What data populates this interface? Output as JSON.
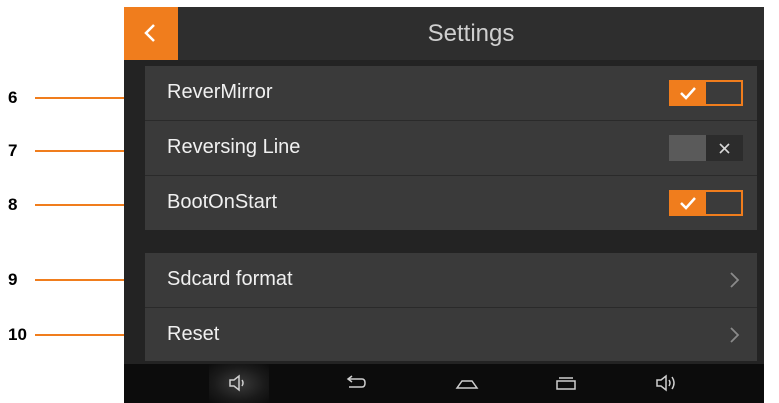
{
  "header": {
    "title": "Settings",
    "back_icon": "chevron-left-icon"
  },
  "settings": {
    "toggles": [
      {
        "label": "ReverMirror",
        "state": "on"
      },
      {
        "label": "Reversing Line",
        "state": "off"
      },
      {
        "label": "BootOnStart",
        "state": "on"
      }
    ],
    "actions": [
      {
        "label": "Sdcard format"
      },
      {
        "label": "Reset"
      }
    ]
  },
  "callouts": [
    "6",
    "7",
    "8",
    "9",
    "10"
  ],
  "navbar": {
    "icons": [
      "volume-down-icon",
      "back-icon",
      "home-icon",
      "recent-apps-icon",
      "volume-up-icon"
    ]
  },
  "colors": {
    "accent": "#f07d1d",
    "background": "#232323",
    "row": "#3a3a3a",
    "navbar": "#0c0c0c"
  }
}
